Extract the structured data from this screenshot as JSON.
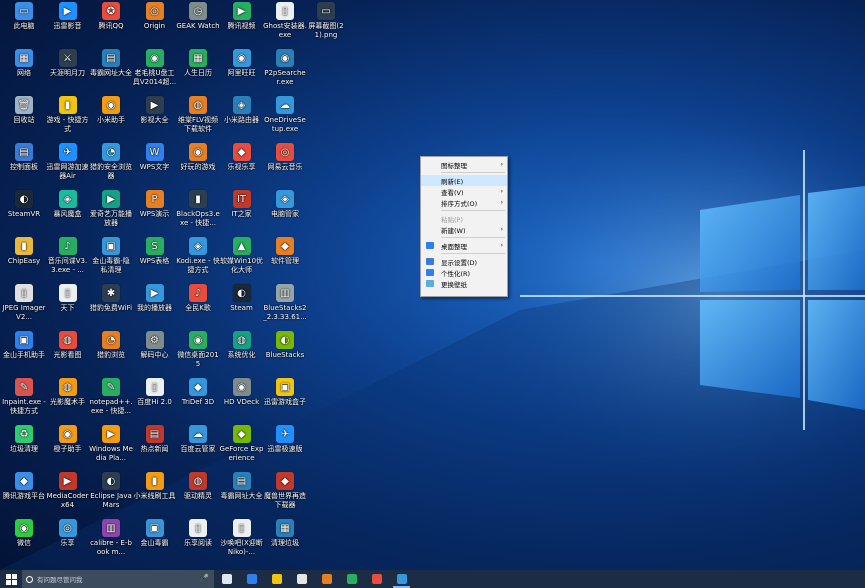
{
  "desktop": {
    "icons": [
      {
        "label": "此电脑",
        "color": "#3a8ee6",
        "glyph": "▭"
      },
      {
        "label": "网络",
        "color": "#3a8ee6",
        "glyph": "▦"
      },
      {
        "label": "回收站",
        "color": "#9fb3c8",
        "glyph": "🗑"
      },
      {
        "label": "控制面板",
        "color": "#3a7bd5",
        "glyph": "▤"
      },
      {
        "label": "SteamVR",
        "color": "#1b2838",
        "glyph": "◐"
      },
      {
        "label": "ChipEasy",
        "color": "#e8b93a",
        "glyph": "▮"
      },
      {
        "label": "JPEG Imager V2...",
        "color": "#e0e0e0",
        "glyph": "▯"
      },
      {
        "label": "金山手机助手",
        "color": "#2f80ed",
        "glyph": "▣"
      },
      {
        "label": "Inpaint.exe - 快捷方式",
        "color": "#d9534f",
        "glyph": "✎"
      },
      {
        "label": "垃圾清理",
        "color": "#2ecc71",
        "glyph": "♻"
      },
      {
        "label": "腾讯游戏平台",
        "color": "#3a8ee6",
        "glyph": "◆"
      },
      {
        "label": "微信",
        "color": "#2ecc40",
        "glyph": "◉"
      },
      {
        "label": "迅雷影音",
        "color": "#1e90ff",
        "glyph": "▶"
      },
      {
        "label": "天涯明月刀",
        "color": "#2d3e50",
        "glyph": "⚔"
      },
      {
        "label": "游戏 - 快捷方式",
        "color": "#f1c40f",
        "glyph": "▮"
      },
      {
        "label": "迅雷网游加速器Air",
        "color": "#1e90ff",
        "glyph": "✈"
      },
      {
        "label": "暴风魔盒",
        "color": "#1abc9c",
        "glyph": "◈"
      },
      {
        "label": "音乐间谍V3.3.exe - ...",
        "color": "#27ae60",
        "glyph": "♪"
      },
      {
        "label": "天下",
        "color": "#ecf0f1",
        "glyph": "▯"
      },
      {
        "label": "光影看图",
        "color": "#e74c3c",
        "glyph": "◍"
      },
      {
        "label": "光影魔术手",
        "color": "#f39c12",
        "glyph": "◍"
      },
      {
        "label": "橙子助手",
        "color": "#f39c12",
        "glyph": "◉"
      },
      {
        "label": "MediaCoder x64",
        "color": "#c0392b",
        "glyph": "▶"
      },
      {
        "label": "乐享",
        "color": "#3498db",
        "glyph": "◎"
      },
      {
        "label": "腾讯QQ",
        "color": "#e74c3c",
        "glyph": "✪"
      },
      {
        "label": "毒霸网址大全",
        "color": "#2980b9",
        "glyph": "▤"
      },
      {
        "label": "小米助手",
        "color": "#f39c12",
        "glyph": "◉"
      },
      {
        "label": "猎豹安全浏览器",
        "color": "#3498db",
        "glyph": "◔"
      },
      {
        "label": "爱奇艺万能播放器",
        "color": "#16a085",
        "glyph": "▶"
      },
      {
        "label": "金山毒霸-隐私清理",
        "color": "#3498db",
        "glyph": "▣"
      },
      {
        "label": "猎豹免费WiFi",
        "color": "#2c3e50",
        "glyph": "✱"
      },
      {
        "label": "猎豹浏览",
        "color": "#e67e22",
        "glyph": "◔"
      },
      {
        "label": "notepad++.exe - 快捷...",
        "color": "#27ae60",
        "glyph": "✎"
      },
      {
        "label": "Windows Media Pla...",
        "color": "#f39c12",
        "glyph": "▶"
      },
      {
        "label": "Eclipse Java Mars",
        "color": "#2c3e50",
        "glyph": "◐"
      },
      {
        "label": "calibre - E-book m...",
        "color": "#8e44ad",
        "glyph": "▥"
      },
      {
        "label": "Origin",
        "color": "#e67e22",
        "glyph": "◎"
      },
      {
        "label": "老毛桃U盘工具V2014超...",
        "color": "#27ae60",
        "glyph": "◉"
      },
      {
        "label": "影视大全",
        "color": "#2c3e50",
        "glyph": "▶"
      },
      {
        "label": "WPS文字",
        "color": "#2f80ed",
        "glyph": "W"
      },
      {
        "label": "WPS演示",
        "color": "#e67e22",
        "glyph": "P"
      },
      {
        "label": "WPS表格",
        "color": "#27ae60",
        "glyph": "S"
      },
      {
        "label": "我的播放器",
        "color": "#3498db",
        "glyph": "▶"
      },
      {
        "label": "解码中心",
        "color": "#7f8c8d",
        "glyph": "⚙"
      },
      {
        "label": "百度Hi 2.0",
        "color": "#ecf0f1",
        "glyph": "▯"
      },
      {
        "label": "热点新闻",
        "color": "#c0392b",
        "glyph": "▤"
      },
      {
        "label": "小米线刷工具",
        "color": "#f39c12",
        "glyph": "▮"
      },
      {
        "label": "金山毒霸",
        "color": "#3498db",
        "glyph": "▣"
      },
      {
        "label": "GEAK Watch",
        "color": "#7f8c8d",
        "glyph": "◷"
      },
      {
        "label": "人生日历",
        "color": "#27ae60",
        "glyph": "▦"
      },
      {
        "label": "维棠FLV视频下载软件",
        "color": "#e67e22",
        "glyph": "◍"
      },
      {
        "label": "好玩的游戏",
        "color": "#e67e22",
        "glyph": "◉"
      },
      {
        "label": "BlackOps3.exe - 快捷...",
        "color": "#2c3e50",
        "glyph": "▮"
      },
      {
        "label": "Kodi.exe - 快捷方式",
        "color": "#3498db",
        "glyph": "◈"
      },
      {
        "label": "全民K歌",
        "color": "#e74c3c",
        "glyph": "♪"
      },
      {
        "label": "微信桌面2015",
        "color": "#27ae60",
        "glyph": "◉"
      },
      {
        "label": "TriDef 3D",
        "color": "#3498db",
        "glyph": "◆"
      },
      {
        "label": "百度云管家",
        "color": "#3498db",
        "glyph": "☁"
      },
      {
        "label": "驱动精灵",
        "color": "#c0392b",
        "glyph": "◍"
      },
      {
        "label": "乐享阅读",
        "color": "#ecf0f1",
        "glyph": "▯"
      },
      {
        "label": "腾讯视频",
        "color": "#27ae60",
        "glyph": "▶"
      },
      {
        "label": "阿里旺旺",
        "color": "#3498db",
        "glyph": "◉"
      },
      {
        "label": "小米路由器",
        "color": "#2980b9",
        "glyph": "◈"
      },
      {
        "label": "乐视乐享",
        "color": "#e74c3c",
        "glyph": "◆"
      },
      {
        "label": "IT之家",
        "color": "#c0392b",
        "glyph": "IT"
      },
      {
        "label": "软媒Win10优化大师",
        "color": "#27ae60",
        "glyph": "▲"
      },
      {
        "label": "Steam",
        "color": "#1b2838",
        "glyph": "◐"
      },
      {
        "label": "系统优化",
        "color": "#16a085",
        "glyph": "◍"
      },
      {
        "label": "HD VDeck",
        "color": "#7f8c8d",
        "glyph": "◉"
      },
      {
        "label": "GeForce Experience",
        "color": "#76b900",
        "glyph": "◆"
      },
      {
        "label": "毒霸网址大全",
        "color": "#2980b9",
        "glyph": "▤"
      },
      {
        "label": "沙唤吧(X迎断Niko)-...",
        "color": "#ecf0f1",
        "glyph": "▯"
      },
      {
        "label": "Ghost安装器.exe",
        "color": "#ecf0f1",
        "glyph": "▯"
      },
      {
        "label": "P2pSearcher.exe",
        "color": "#2980b9",
        "glyph": "◉"
      },
      {
        "label": "OneDriveSetup.exe",
        "color": "#3498db",
        "glyph": "☁"
      },
      {
        "label": "网易云音乐",
        "color": "#e74c3c",
        "glyph": "◎"
      },
      {
        "label": "电脑管家",
        "color": "#3498db",
        "glyph": "◈"
      },
      {
        "label": "软件管理",
        "color": "#e67e22",
        "glyph": "◆"
      },
      {
        "label": "BlueStacks2_2.3.33.61...",
        "color": "#95a5a6",
        "glyph": "▥"
      },
      {
        "label": "BlueStacks",
        "color": "#76b900",
        "glyph": "◐"
      },
      {
        "label": "迅雷游戏盒子",
        "color": "#f1c40f",
        "glyph": "▣"
      },
      {
        "label": "迅雷极速版",
        "color": "#1e90ff",
        "glyph": "✈"
      },
      {
        "label": "魔兽世界再造下载器",
        "color": "#c0392b",
        "glyph": "◆"
      },
      {
        "label": "清理垃圾",
        "color": "#2980b9",
        "glyph": "▦"
      }
    ],
    "extra_icon": {
      "label": "屏幕截图(21).png",
      "color": "#2c3e50",
      "glyph": "▭"
    }
  },
  "context_menu": {
    "items": [
      {
        "label": "图标整理",
        "type": "item",
        "arrow": true,
        "icon": false
      },
      {
        "type": "sep"
      },
      {
        "label": "刷新(E)",
        "type": "item",
        "selected": true
      },
      {
        "label": "查看(V)",
        "type": "item",
        "arrow": true
      },
      {
        "label": "排序方式(O)",
        "type": "item",
        "arrow": true
      },
      {
        "type": "sep"
      },
      {
        "label": "粘贴(P)",
        "type": "item",
        "disabled": true
      },
      {
        "label": "新建(W)",
        "type": "item",
        "arrow": true
      },
      {
        "type": "sep"
      },
      {
        "label": "桌面整理",
        "type": "item",
        "arrow": true,
        "icon": true,
        "icon_color": "#2f80ed"
      },
      {
        "type": "sep"
      },
      {
        "label": "显示设置(D)",
        "type": "item",
        "icon": true,
        "icon_color": "#3a7bd5"
      },
      {
        "label": "个性化(R)",
        "type": "item",
        "icon": true,
        "icon_color": "#2f80ed"
      },
      {
        "label": "更换壁纸",
        "type": "item",
        "icon": true,
        "icon_color": "#5dade2"
      }
    ]
  },
  "taskbar": {
    "search_placeholder": "有问题尽管问我",
    "items": [
      {
        "name": "task-view",
        "color": "#dfe6ee",
        "glyph": "▭"
      },
      {
        "name": "edge",
        "color": "#2f80ed",
        "glyph": "e"
      },
      {
        "name": "file-explorer",
        "color": "#f1c40f",
        "glyph": "▬"
      },
      {
        "name": "store",
        "color": "#e5e5e5",
        "glyph": "▦"
      },
      {
        "name": "app-orange",
        "color": "#e67e22",
        "glyph": "◉"
      },
      {
        "name": "app-green",
        "color": "#27ae60",
        "glyph": "◉"
      },
      {
        "name": "app-red",
        "color": "#e74c3c",
        "glyph": "▮"
      },
      {
        "name": "app-blue",
        "color": "#3498db",
        "glyph": "▣",
        "active": true
      }
    ]
  }
}
